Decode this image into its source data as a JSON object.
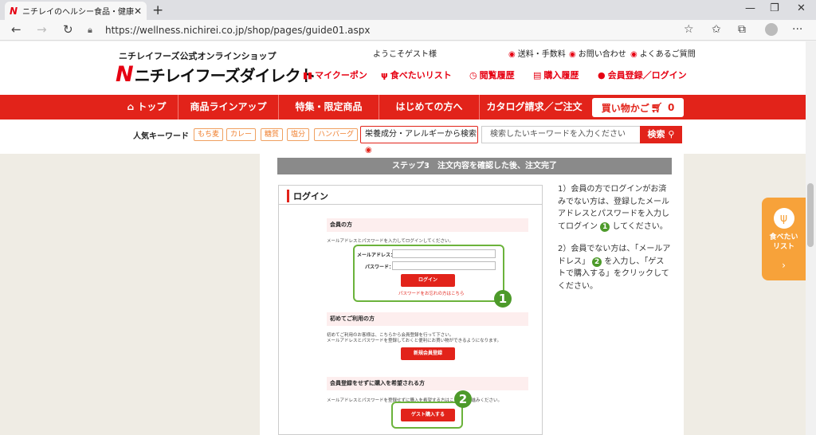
{
  "browser": {
    "tab_title": "ニチレイのヘルシー食品・健康管理食",
    "tab_favicon": "N",
    "url": "https://wellness.nichirei.co.jp/shop/pages/guide01.aspx"
  },
  "header": {
    "shop_subtitle": "ニチレイフーズ公式オンラインショップ",
    "logo_mark": "N",
    "logo_text": "ニチレイフーズダイレクト",
    "welcome": "ようこそゲスト様",
    "top_links": [
      "送料・手数料",
      "お問い合わせ",
      "よくあるご質問"
    ],
    "util_links": [
      {
        "icon": "coupon-icon",
        "glyph": "▮▮",
        "label": "マイクーポン"
      },
      {
        "icon": "fork-icon",
        "glyph": "ψ",
        "label": "食べたいリスト"
      },
      {
        "icon": "clock-icon",
        "glyph": "◷",
        "label": "閲覧履歴"
      },
      {
        "icon": "document-icon",
        "glyph": "▤",
        "label": "購入履歴"
      },
      {
        "icon": "person-icon",
        "glyph": "●",
        "label": "会員登録／ログイン"
      }
    ]
  },
  "nav": {
    "items": [
      "トップ",
      "商品ラインアップ",
      "特集・限定商品",
      "はじめての方へ",
      "カタログ請求／ご注文"
    ],
    "home_icon": "home-icon",
    "cart_label": "買い物かご",
    "cart_count": "0"
  },
  "keywords": {
    "label": "人気キーワード",
    "items": [
      "もち麦",
      "カレー",
      "糖質",
      "塩分",
      "ハンバーグ"
    ],
    "allergy_label": "栄養成分・アレルギーから検索",
    "search_placeholder": "検索したいキーワードを入力ください",
    "search_button": "検索"
  },
  "main": {
    "step_title": "ステップ3　注文内容を確認した後、注文完了",
    "login_title": "ログイン",
    "member": {
      "heading": "会員の方",
      "desc": "メールアドレスとパスワードを入力してログインしてください。",
      "email_label": "メールアドレス：",
      "password_label": "パスワード：",
      "login_button": "ログイン",
      "forgot": "パスワードをお忘れの方はこちら"
    },
    "first": {
      "heading": "初めてご利用の方",
      "desc1": "初めてご利用のお客様は、こちらから会員登録を行って下さい。",
      "desc2": "メールアドレスとパスワードを登録しておくと便利にお買い物ができるようになります。",
      "register_button": "新規会員登録"
    },
    "guest": {
      "heading": "会員登録をせずに購入を希望される方",
      "desc": "メールアドレスとパスワードを登録せずに購入を希望する方はこちらへお進みください。",
      "guest_button": "ゲスト購入する"
    },
    "badges": [
      "1",
      "2"
    ]
  },
  "instructions": {
    "p1_a": "1）会員の方でログインがお済みでない方は、登録したメールアドレスとパスワードを入力してログイン",
    "p1_b": "してください。",
    "p2_a": "2）会員でない方は、「メールアドレス」",
    "p2_b": "を入力し、「ゲストで購入する」をクリックしてください。"
  },
  "side_button": {
    "label1": "食べたい",
    "label2": "リスト",
    "arrow": "›"
  }
}
